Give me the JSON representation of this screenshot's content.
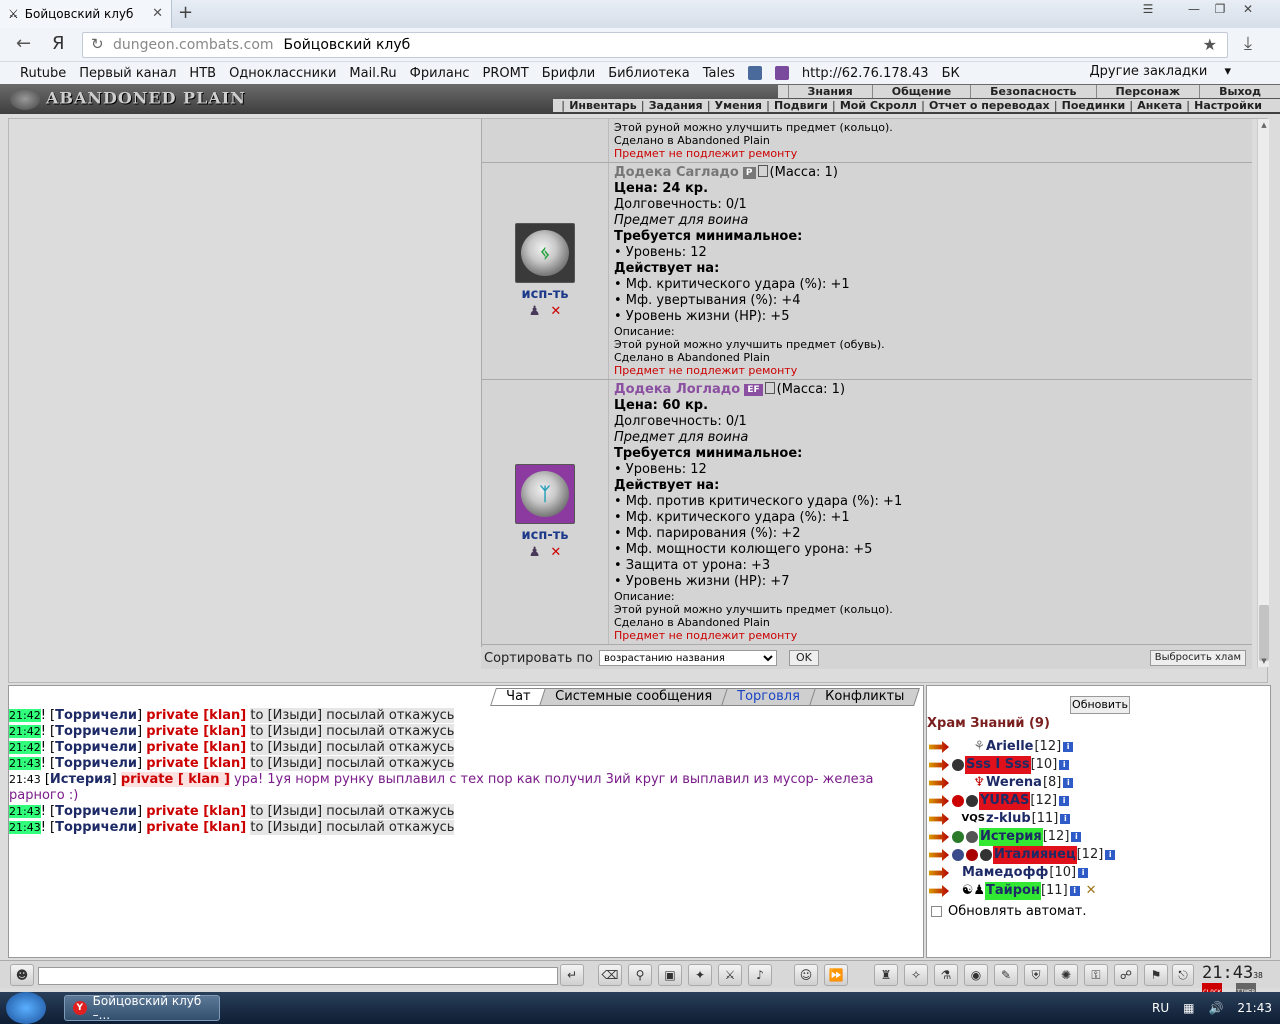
{
  "browser": {
    "tab_title": "Бойцовский клуб",
    "address_domain": "dungeon.combats.com",
    "address_title": "Бойцовский клуб",
    "bookmarks": [
      "Rutube",
      "Первый канал",
      "НТВ",
      "Одноклассники",
      "Mail.Ru",
      "Фриланс",
      "PROMT",
      "Брифли",
      "Библиотека",
      "Tales",
      "http://62.76.178.43",
      "БК"
    ],
    "other_bookmarks": "Другие закладки"
  },
  "game": {
    "logo": "ABANDONED PLAIN",
    "top_menu": [
      "Знания",
      "Общение",
      "Безопасность",
      "Персонаж",
      "Выход"
    ],
    "sub_menu": [
      "Инвентарь",
      "Задания",
      "Умения",
      "Подвиги",
      "Мой Скролл",
      "Отчет о переводах",
      "Поединки",
      "Анкета",
      "Настройки"
    ]
  },
  "items": {
    "prev_tail": {
      "desc": "Этой руной можно улучшить предмет (кольцо).",
      "made": "Сделано в Abandoned Plain",
      "norepair": "Предмет не подлежит ремонту"
    },
    "item1": {
      "name": "Додека Сагладо",
      "badge": "P",
      "mass": "(Масса: 1)",
      "price": "Цена: 24 кр.",
      "durability": "Долговечность: 0/1",
      "for": "Предмет для воина",
      "req_title": "Требуется минимальное:",
      "req_level": "• Уровень: 12",
      "eff_title": "Действует на:",
      "eff1": "• Мф. критического удара (%): +1",
      "eff2": "• Мф. увертывания (%): +4",
      "eff3": "• Уровень жизни (HP): +5",
      "desc_label": "Описание:",
      "desc": "Этой руной можно улучшить предмет (обувь).",
      "made": "Сделано в Abandoned Plain",
      "norepair": "Предмет не подлежит ремонту",
      "use": "исп-ть"
    },
    "item2": {
      "name": "Додека Логладо",
      "badge": "EF",
      "mass": "(Масса: 1)",
      "price": "Цена: 60 кр.",
      "durability": "Долговечность: 0/1",
      "for": "Предмет для воина",
      "req_title": "Требуется минимальное:",
      "req_level": "• Уровень: 12",
      "eff_title": "Действует на:",
      "eff1": "• Мф. против критического удара (%): +1",
      "eff2": "• Мф. критического удара (%): +1",
      "eff3": "• Мф. парирования (%): +2",
      "eff4": "• Мф. мощности колющего урона: +5",
      "eff5": "• Защита от урона: +3",
      "eff6": "• Уровень жизни (HP): +7",
      "desc_label": "Описание:",
      "desc": "Этой руной можно улучшить предмет (кольцо).",
      "made": "Сделано в Abandoned Plain",
      "norepair": "Предмет не подлежит ремонту",
      "use": "исп-ть"
    },
    "sort_label": "Сортировать по",
    "sort_value": "возрастанию названия",
    "ok": "OK",
    "junk": "Выбросить хлам"
  },
  "chat": {
    "tabs": [
      "Чат",
      "Системные сообщения",
      "Торговля",
      "Конфликты"
    ],
    "msgs": [
      {
        "time": "21:42",
        "who": "Торричели",
        "priv": "private [klan]",
        "to": "to [Изыди] посылай откажусь"
      },
      {
        "time": "21:42",
        "who": "Торричели",
        "priv": "private [klan]",
        "to": "to [Изыди] посылай откажусь"
      },
      {
        "time": "21:42",
        "who": "Торричели",
        "priv": "private [klan]",
        "to": "to [Изыди] посылай откажусь"
      },
      {
        "time": "21:43",
        "who": "Торричели",
        "priv": "private [klan]",
        "to": "to [Изыди] посылай откажусь"
      }
    ],
    "special": {
      "time": "21:43",
      "who": "Истерия",
      "priv": "private [ klan ]",
      "text": "ура! 1уя норм рунку выплавил с тех пор как получил 3ий круг и выплавил из мусор- железа",
      "text2": "рарного :)"
    },
    "msgs2": [
      {
        "time": "21:43",
        "who": "Торричели",
        "priv": "private [klan]",
        "to": "to [Изыди] посылай откажусь"
      },
      {
        "time": "21:43",
        "who": "Торричели",
        "priv": "private [klan]",
        "to": "to [Изыди] посылай откажусь"
      }
    ]
  },
  "room": {
    "refresh": "Обновить",
    "title": "Храм Знаний (9)",
    "users": [
      {
        "name": "Arielle",
        "lvl": "[12]"
      },
      {
        "name": "Sss I Sss",
        "lvl": "[10]"
      },
      {
        "name": "Werena",
        "lvl": "[8]"
      },
      {
        "name": "YURAS",
        "lvl": "[12]"
      },
      {
        "name": "z-klub",
        "lvl": "[11]"
      },
      {
        "name": "Истерия",
        "lvl": "[12]"
      },
      {
        "name": "Италиянец",
        "lvl": "[12]"
      },
      {
        "name": "Мамедофф",
        "lvl": "[10]"
      },
      {
        "name": "Тайрон",
        "lvl": "[11]"
      }
    ],
    "auto": "Обновлять автомат."
  },
  "clock": {
    "time": "21:43",
    "sec": "38",
    "label": "CLOCK",
    "timer": "TIMER"
  },
  "taskbar": {
    "task": "Бойцовский клуб –...",
    "lang": "RU",
    "time": "21:43"
  }
}
